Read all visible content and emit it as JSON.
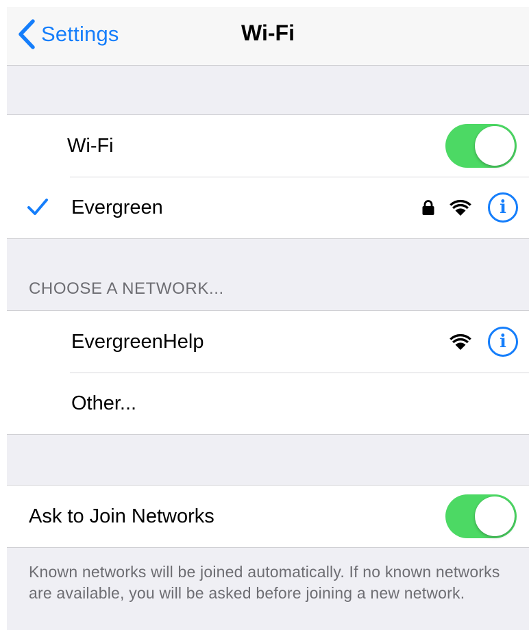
{
  "navbar": {
    "back_label": "Settings",
    "title": "Wi-Fi"
  },
  "wifi_toggle": {
    "label": "Wi-Fi",
    "on": true
  },
  "connected_network": {
    "name": "Evergreen",
    "secured": true,
    "info_glyph": "i"
  },
  "choose_network": {
    "header": "CHOOSE A NETWORK...",
    "networks": [
      {
        "name": "EvergreenHelp",
        "secured": false,
        "info_glyph": "i"
      }
    ],
    "other_label": "Other..."
  },
  "ask_to_join": {
    "label": "Ask to Join Networks",
    "on": true,
    "footer": "Known networks will be joined automatically. If no known networks are available, you will be asked before joining a new network."
  },
  "colors": {
    "accent": "#157efb",
    "toggle_on": "#4cd964",
    "background": "#efeff4",
    "secondary_text": "#6d6d72"
  },
  "icons": [
    "chevron-left-icon",
    "checkmark-icon",
    "lock-icon",
    "wifi-signal-icon",
    "info-icon"
  ]
}
